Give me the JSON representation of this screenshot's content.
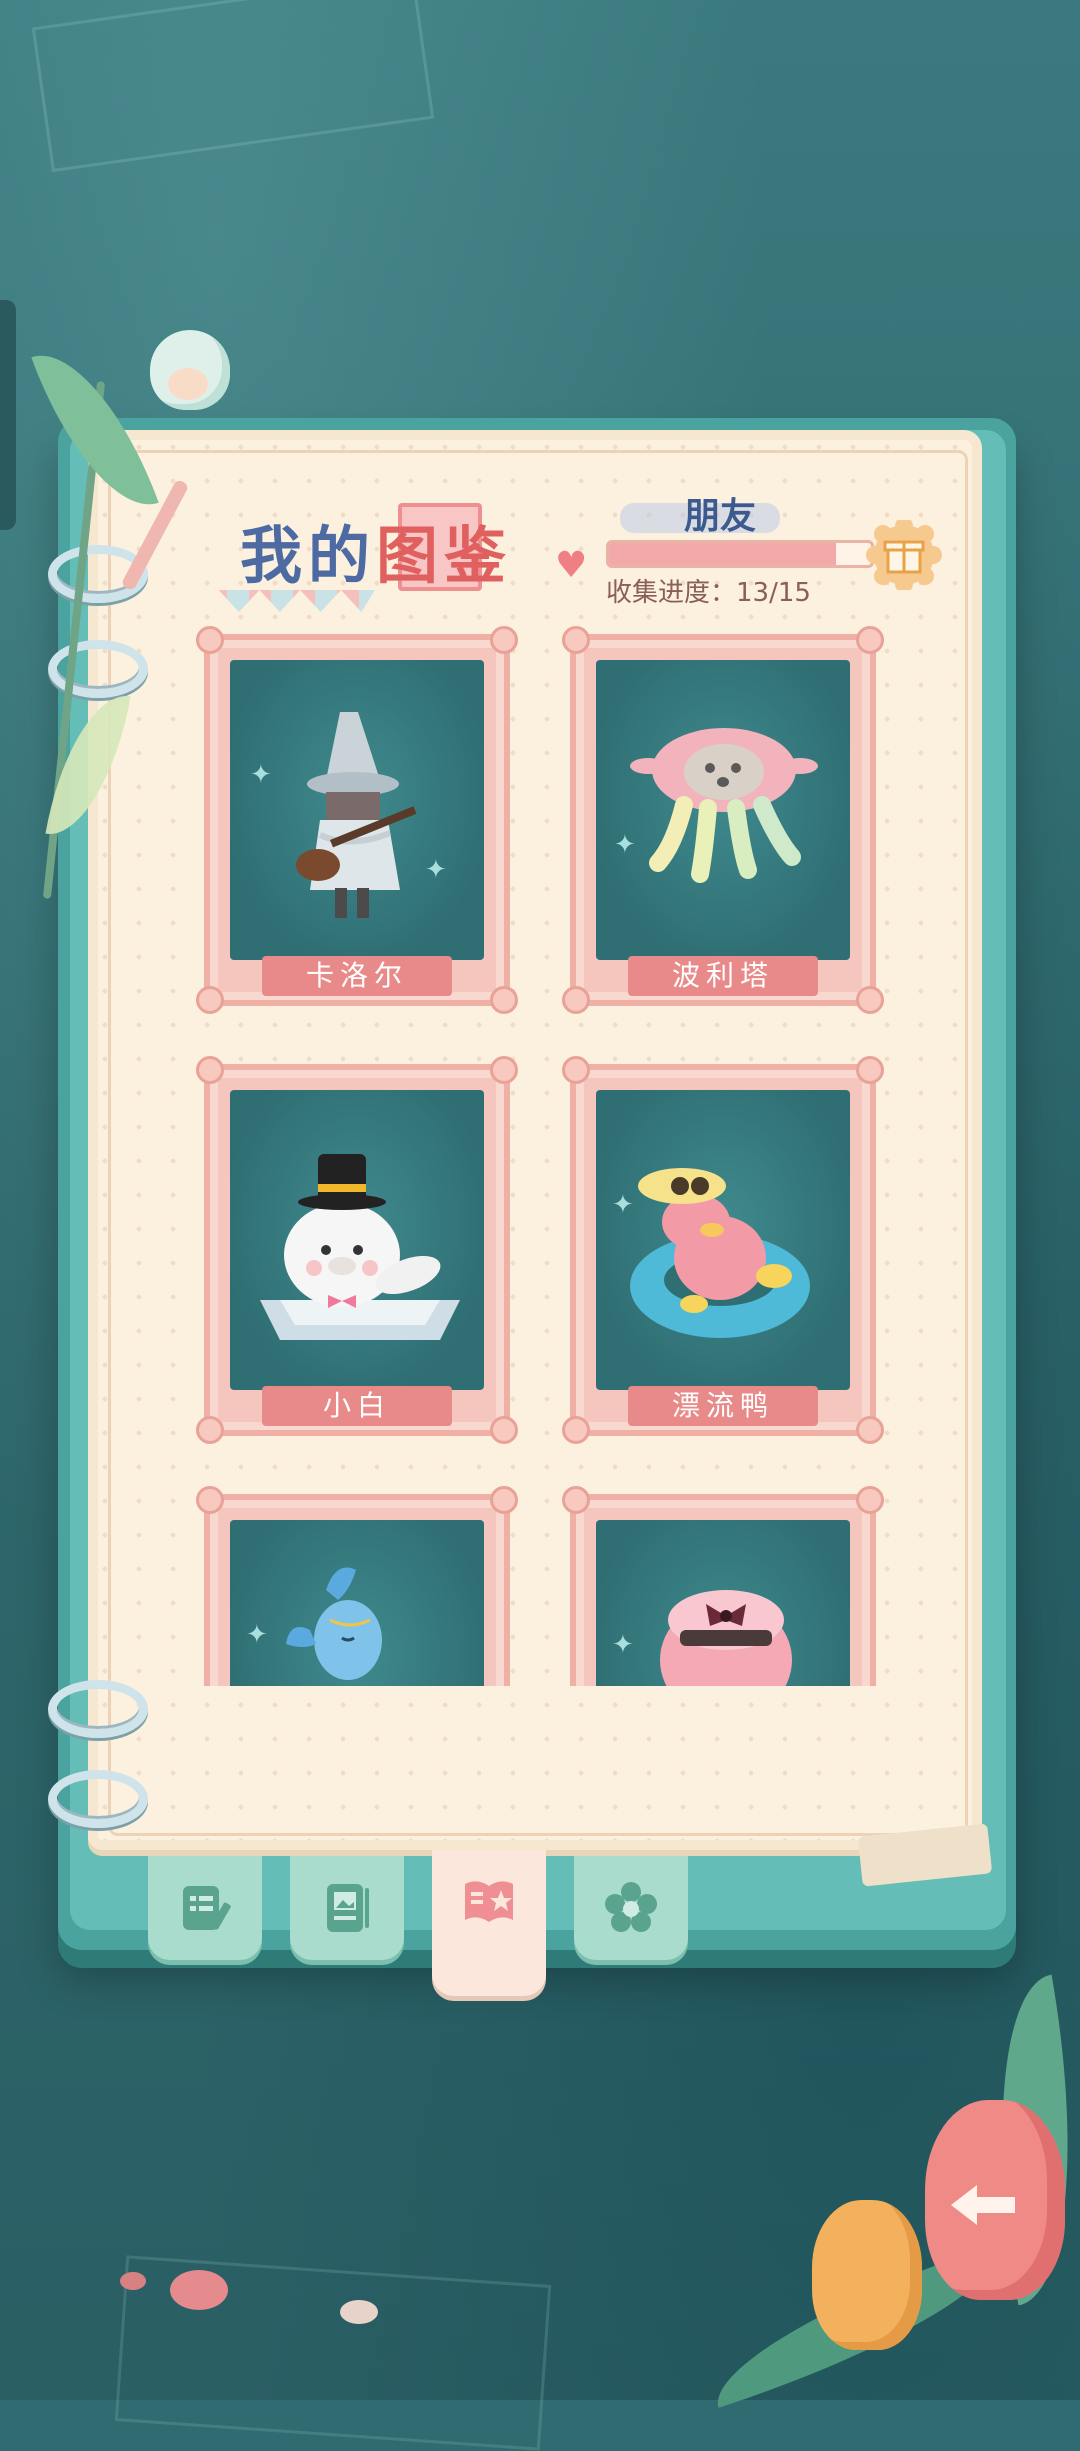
{
  "header": {
    "title_part1": "我的",
    "title_highlight": "图",
    "title_part2": "鉴",
    "category": "朋友",
    "progress_label": "收集进度：13/15",
    "progress_fraction": 0.867
  },
  "cards": [
    {
      "name": "卡洛尔",
      "art": "wizard-guitar-character"
    },
    {
      "name": "波利塔",
      "art": "jellyfish-character"
    },
    {
      "name": "小白",
      "art": "seal-with-top-hat"
    },
    {
      "name": "漂流鸭",
      "art": "pink-duck-in-swim-ring"
    },
    {
      "name": "",
      "art": "blue-bird-character"
    },
    {
      "name": "",
      "art": "pink-bear-with-bow"
    }
  ],
  "tabs": [
    {
      "icon": "notes-pencil-icon",
      "active": false
    },
    {
      "icon": "photo-album-icon",
      "active": false
    },
    {
      "icon": "collection-book-icon",
      "active": true
    },
    {
      "icon": "flower-icon",
      "active": false
    }
  ],
  "colors": {
    "background": "#2f6b70",
    "page": "#fbf1de",
    "accent_pink": "#e98a8a",
    "title_blue": "#4d6aa3",
    "card_art_bg": "#2f6e73"
  }
}
